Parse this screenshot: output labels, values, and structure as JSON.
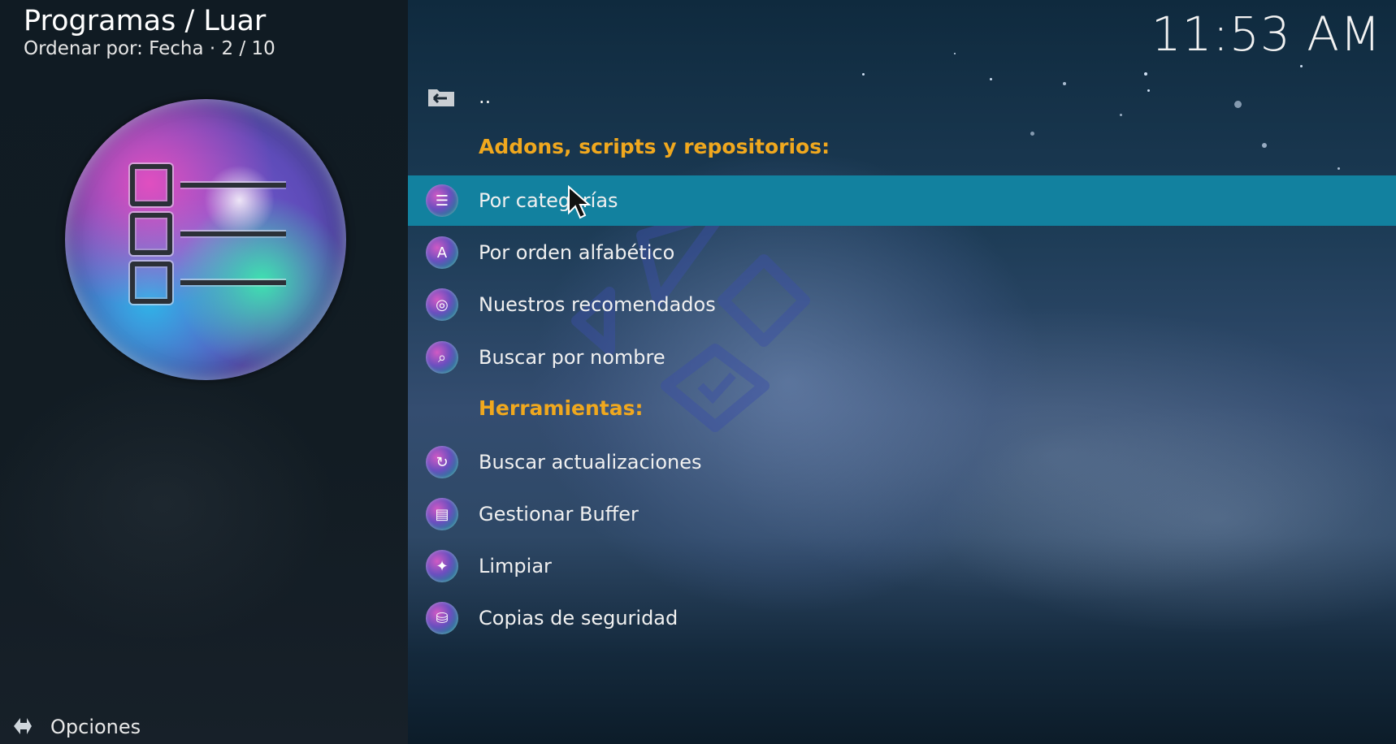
{
  "header": {
    "title": "Programas / Luar",
    "subtitle": "Ordenar por: Fecha  ·  2 / 10"
  },
  "clock": "11:53 AM",
  "left_panel": {
    "options_label": "Opciones",
    "options_icon": "gear-icon"
  },
  "list": {
    "parent_label": "..",
    "items": [
      {
        "type": "header",
        "label": "Addons, scripts y repositorios:"
      },
      {
        "type": "item",
        "label": "Por categorías",
        "icon": "categories-icon",
        "selected": true
      },
      {
        "type": "item",
        "label": "Por orden alfabético",
        "icon": "alphabetical-icon"
      },
      {
        "type": "item",
        "label": "Nuestros recomendados",
        "icon": "recommended-icon"
      },
      {
        "type": "item",
        "label": "Buscar por nombre",
        "icon": "search-icon"
      },
      {
        "type": "header",
        "label": "Herramientas:"
      },
      {
        "type": "item",
        "label": "Buscar actualizaciones",
        "icon": "updates-icon"
      },
      {
        "type": "item",
        "label": "Gestionar Buffer",
        "icon": "buffer-icon"
      },
      {
        "type": "item",
        "label": "Limpiar",
        "icon": "clean-icon"
      },
      {
        "type": "item",
        "label": "Copias de seguridad",
        "icon": "backup-icon"
      }
    ]
  },
  "colors": {
    "selection": "#12819f",
    "section_header": "#f0a81e",
    "left_panel": "#101b23"
  }
}
